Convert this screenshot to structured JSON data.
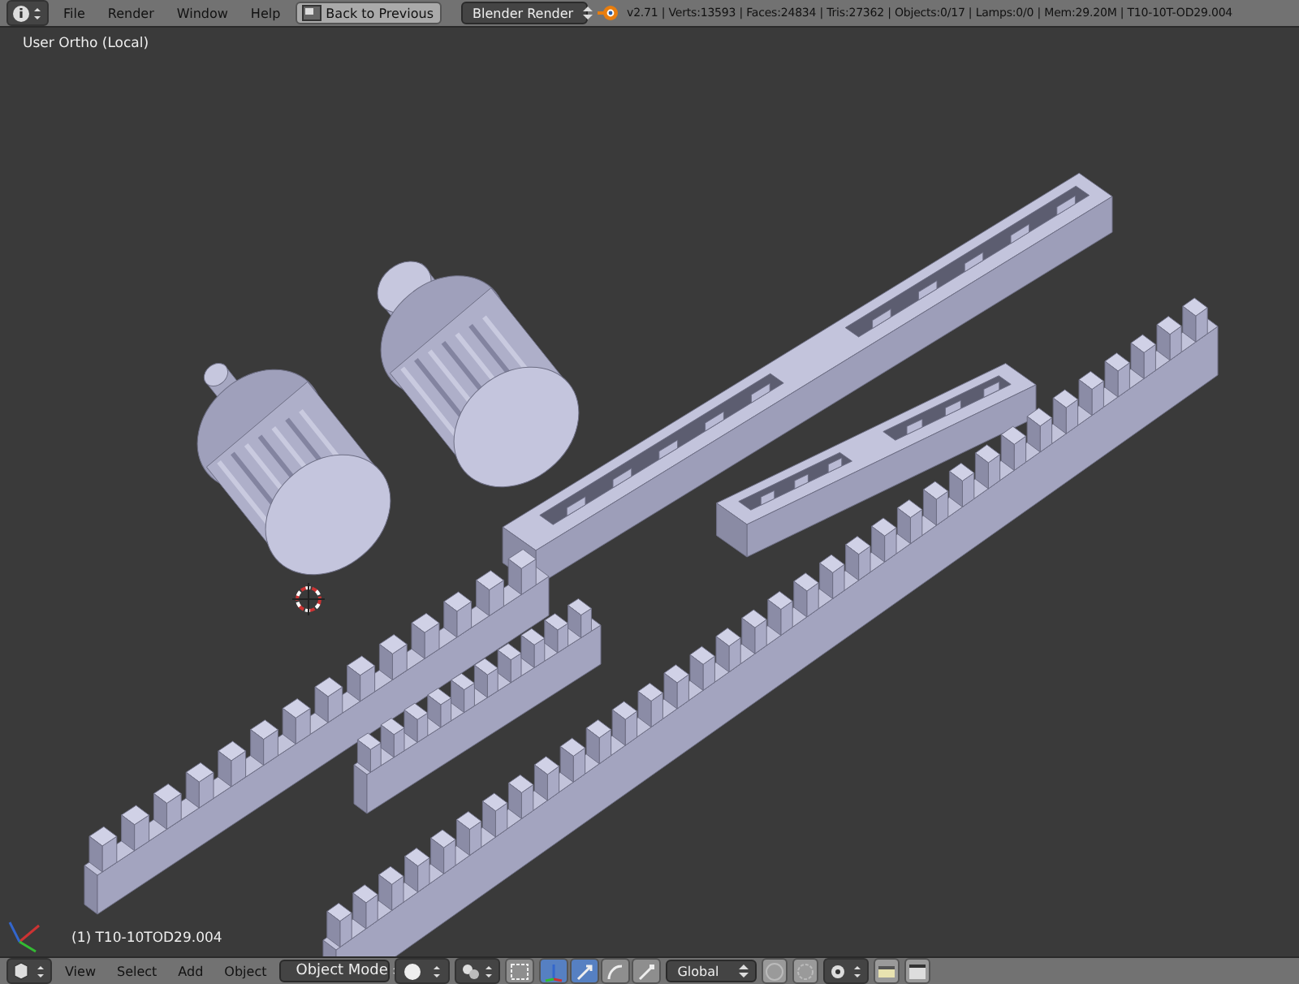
{
  "top_bar": {
    "menus": [
      "File",
      "Render",
      "Window",
      "Help"
    ],
    "back_button": "Back to Previous",
    "render_engine": "Blender Render",
    "stats": "v2.71 | Verts:13593 | Faces:24834 | Tris:27362 | Objects:0/17 | Lamps:0/0 | Mem:29.20M | T10-10T-OD29.004"
  },
  "viewport": {
    "view_label": "User Ortho (Local)",
    "object_label": "(1) T10-10TOD29.004"
  },
  "bottom_bar": {
    "menus": [
      "View",
      "Select",
      "Add",
      "Object"
    ],
    "mode": "Object Mode",
    "manipulator_enabled": true,
    "manipulators": [
      {
        "kind": "translate",
        "selected": true
      },
      {
        "kind": "rotate",
        "selected": false
      },
      {
        "kind": "scale",
        "selected": false
      }
    ],
    "orientation": "Global"
  }
}
